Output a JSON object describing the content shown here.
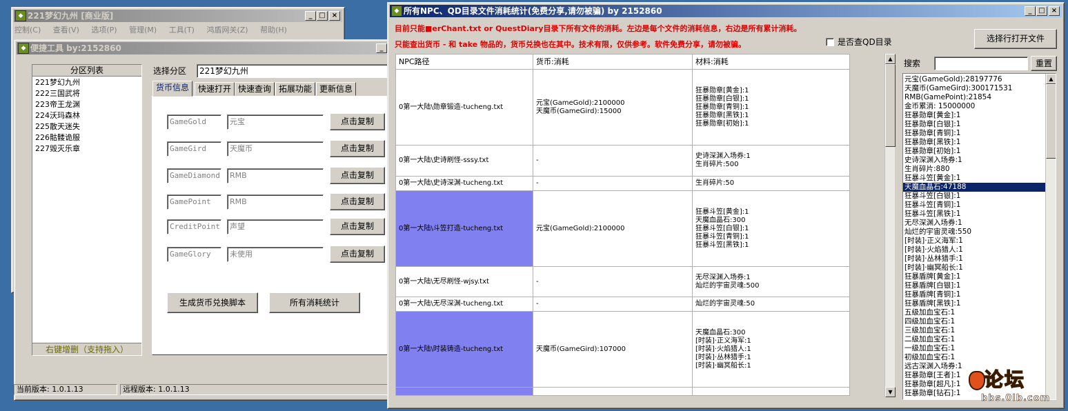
{
  "main_window": {
    "title": "221梦幻九州 [商业版]",
    "menu": [
      "控制(C)",
      "查看(V)",
      "选项(P)",
      "管理(M)",
      "工具(T)",
      "鸿盾网关(Z)",
      "帮助(H)"
    ]
  },
  "tool_window": {
    "title": "便捷工具  by:2152860",
    "zone_list": {
      "header": "分区列表",
      "items": [
        "221梦幻九州",
        "222三国武将",
        "223帝王龙渊",
        "224沃玛森林",
        "225散天迷失",
        "226骷髅诡服",
        "227毁灭乐章"
      ],
      "footer": "右键增删（支持拖入）"
    },
    "select_zone_label": "选择分区",
    "select_zone_value": "221梦幻九州",
    "tabs": [
      "货币信息",
      "快速打开",
      "快速查询",
      "拓展功能",
      "更新信息"
    ],
    "currency_rows": [
      {
        "code": "GameGold",
        "name": "元宝",
        "button": "点击复制"
      },
      {
        "code": "GameGird",
        "name": "天魔币",
        "button": "点击复制"
      },
      {
        "code": "GameDiamond",
        "name": "RMB",
        "button": "点击复制"
      },
      {
        "code": "GamePoint",
        "name": "RMB",
        "button": "点击复制"
      },
      {
        "code": "CreditPoint",
        "name": "声望",
        "button": "点击复制"
      },
      {
        "code": "GameGlory",
        "name": "未使用",
        "button": "点击复制"
      }
    ],
    "gen_script_button": "生成货币兑换脚本",
    "all_stats_button": "所有消耗统计",
    "current_version": "当前版本: 1.0.1.13",
    "remote_version": "远程版本: 1.0.1.13"
  },
  "stats_window": {
    "title": "所有NPC、QD目录文件消耗统计(免费分享,请勿被骗)    by 2152860",
    "notice_line1": "目前只能■erChant.txt or QuestDiary目录下所有文件的消耗。左边是每个文件的消耗信息，右边是所有累计消耗。",
    "notice_line2": "只能查出货币 - 和 take 物品的，货币兑换也在其中。技术有限，仅供参考。软件免费分享，请勿被骗。",
    "check_qd_label": "是否查QD目录",
    "open_file_button": "选择行打开文件",
    "search_label": "搜索",
    "reset_button": "重置",
    "table_headers": [
      "NPC路径",
      "货币:消耗",
      "材料:消耗"
    ],
    "rows": [
      {
        "path": "0第一大陆\\勋章锻造-tucheng.txt",
        "currency": [
          "元宝(GameGold):2100000",
          "天魔币(GameGird):15000"
        ],
        "materials": [
          "狂暴勋章[黄金]:1",
          "狂暴勋章[白银]:1",
          "狂暴勋章[青铜]:1",
          "狂暴勋章[黑铁]:1",
          "狂暴勋章[初始]:1"
        ],
        "highlight": false
      },
      {
        "path": "0第一大陆\\史诗刷怪-sssy.txt",
        "currency": [
          "-"
        ],
        "materials": [
          "史诗深渊入场券:1",
          "生肖碎片:500"
        ],
        "highlight": false
      },
      {
        "path": "0第一大陆\\史诗深渊-tucheng.txt",
        "currency": [
          "-"
        ],
        "materials": [
          "生肖碎片:50"
        ],
        "highlight": false
      },
      {
        "path": "0第一大陆\\斗笠打造-tucheng.txt",
        "currency": [
          "元宝(GameGold):2100000"
        ],
        "materials": [
          "狂暴斗笠[黄金]:1",
          "天魔血晶石:300",
          "狂暴斗笠[白银]:1",
          "狂暴斗笠[青铜]:1",
          "狂暴斗笠[黑铁]:1"
        ],
        "highlight": true
      },
      {
        "path": "0第一大陆\\无尽刷怪-wjsy.txt",
        "currency": [
          "-"
        ],
        "materials": [
          "无尽深渊入场券:1",
          "灿烂的宇宙灵魂:500"
        ],
        "highlight": false
      },
      {
        "path": "0第一大陆\\无尽深渊-tucheng.txt",
        "currency": [
          "-"
        ],
        "materials": [
          "灿烂的宇宙灵魂:50"
        ],
        "highlight": false
      },
      {
        "path": "0第一大陆\\时装铸造-tucheng.txt",
        "currency": [
          "天魔币(GameGird):107000"
        ],
        "materials": [
          "天魔血晶石:300",
          "[时装]·正义海军:1",
          "[时装]·火焰猎人:1",
          "[时装]·丛林猎手:1",
          "[时装]·幽冥船长:1"
        ],
        "highlight": true
      }
    ],
    "totals": [
      "元宝(GameGold):28197776",
      "天魔币(GameGird):300171531",
      "RMB(GamePoint):21854",
      "金币累消: 15000000",
      "狂暴勋章[黄金]:1",
      "狂暴勋章[白银]:1",
      "狂暴勋章[青铜]:1",
      "狂暴勋章[黑铁]:1",
      "狂暴勋章[初始]:1",
      "史诗深渊入场券:1",
      "生肖碎片:880",
      "狂暴斗笠[黄金]:1",
      "天魔血晶石:47188",
      "狂暴斗笠[白银]:1",
      "狂暴斗笠[青铜]:1",
      "狂暴斗笠[黑铁]:1",
      "无尽深渊入场券:1",
      "灿烂的宇宙灵魂:550",
      "[时装]·正义海军:1",
      "[时装]·火焰猎人:1",
      "[时装]·丛林猎手:1",
      "[时装]·幽冥船长:1",
      "狂暴盾牌[黄金]:1",
      "狂暴盾牌[白银]:1",
      "狂暴盾牌[青铜]:1",
      "狂暴盾牌[黑铁]:1",
      "五级加血宝石:1",
      "四级加血宝石:1",
      "三级加血宝石:1",
      "二级加血宝石:1",
      "一级加血宝石:1",
      "初级加血宝石:1",
      "远古深渊入场券:1",
      "狂暴勋章[王者]:1",
      "狂暴勋章[超凡]:1",
      "狂暴勋章[钻石]:1"
    ],
    "selected_total_index": 12
  },
  "watermark": {
    "text": "bbs.0lb.com",
    "logo": "论坛"
  },
  "colors": {
    "title_active": "#0a246a",
    "row_highlight": "#8080f0",
    "notice_red": "#e00000",
    "desktop": "#3a6ea5"
  }
}
